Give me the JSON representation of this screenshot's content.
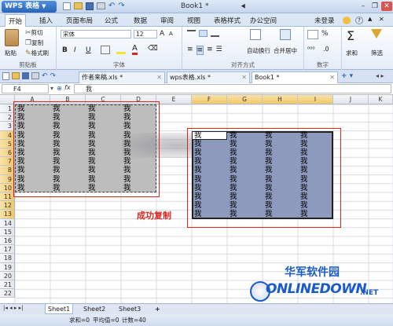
{
  "app": {
    "name": "WPS 表格",
    "doc_title": "Book1 *"
  },
  "window_controls": {
    "min": "–",
    "restore": "❐",
    "close": "✕"
  },
  "ribbon_tabs": [
    "开始",
    "插入",
    "页面布局",
    "公式",
    "数据",
    "审阅",
    "视图",
    "表格样式",
    "办公空间"
  ],
  "ribbon_tabs_right": {
    "status": "未登录",
    "help": "?"
  },
  "clipboard": {
    "paste": "粘贴",
    "cut": "剪切",
    "copy": "复制",
    "format_painter": "格式刷",
    "label": "剪贴板"
  },
  "font": {
    "name": "宋体",
    "size": "12",
    "bold": "B",
    "italic": "I",
    "underline": "U",
    "label": "字体"
  },
  "alignment": {
    "wrap": "自动换行",
    "merge": "合并居中",
    "label": "对齐方式"
  },
  "number": {
    "label": "数字",
    "percent": "%",
    "comma": "⁰⁰⁰"
  },
  "editing": {
    "sum": "求和",
    "filter": "筛选"
  },
  "doc_tabs": [
    {
      "label": "作者来稿.xls *"
    },
    {
      "label": "wps表格.xls *"
    },
    {
      "label": "Book1 *"
    }
  ],
  "formula_bar": {
    "cell_ref": "F4",
    "fx": "fx",
    "value": "我"
  },
  "columns": [
    "A",
    "B",
    "C",
    "D",
    "E",
    "F",
    "G",
    "H",
    "I",
    "J",
    "K"
  ],
  "rows": [
    "1",
    "2",
    "3",
    "4",
    "5",
    "6",
    "7",
    "8",
    "9",
    "10",
    "11",
    "12",
    "13",
    "14",
    "15",
    "16",
    "17",
    "18",
    "19",
    "20",
    "21",
    "22"
  ],
  "cell_char": "我",
  "annotation": "成功复制",
  "sheets": [
    "Sheet1",
    "Sheet2",
    "Sheet3"
  ],
  "add_sheet": "+",
  "status_bar": {
    "sum": "求和=0",
    "avg": "平均值=0",
    "count": "计数=40"
  },
  "watermark": {
    "cn": "华军软件园",
    "en": "ONLINEDOWN",
    "suffix": ".NET"
  },
  "colors": {
    "accent": "#2a64b8",
    "red_box": "#d9261c",
    "source_sel": "#bdbdbd",
    "target_sel": "#8d99bd",
    "watermark_blue": "#1a5bc4"
  }
}
